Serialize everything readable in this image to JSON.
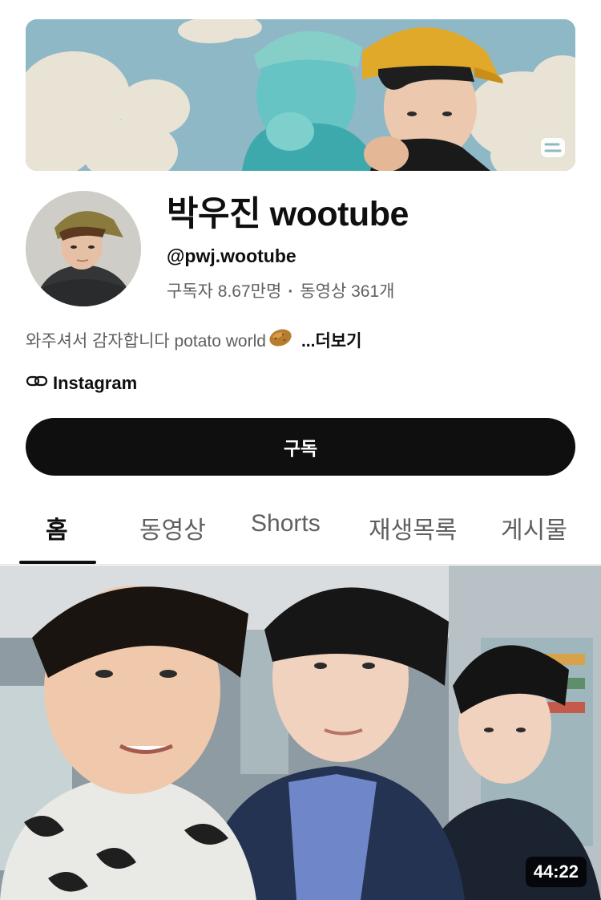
{
  "channel": {
    "name": "박우진 wootube",
    "handle": "@pwj.wootube",
    "subscribers": "구독자 8.67만명",
    "videos": "동영상 361개",
    "description": "와주셔서 감자합니다 potato world",
    "more_label": "...더보기",
    "link_label": "Instagram",
    "subscribe_label": "구독"
  },
  "tabs": [
    {
      "label": "홈",
      "active": true
    },
    {
      "label": "동영상",
      "active": false
    },
    {
      "label": "Shorts",
      "active": false
    },
    {
      "label": "재생목록",
      "active": false
    },
    {
      "label": "게시물",
      "active": false
    }
  ],
  "featured_video": {
    "duration": "44:22"
  },
  "icons": {
    "link": "link-icon",
    "potato": "potato-emoji",
    "banner_logo": "channel-logo-icon"
  },
  "colors": {
    "button_bg": "#0f0f0f",
    "banner_sky": "#8fb8c6",
    "hat_yellow": "#e0a92a"
  }
}
